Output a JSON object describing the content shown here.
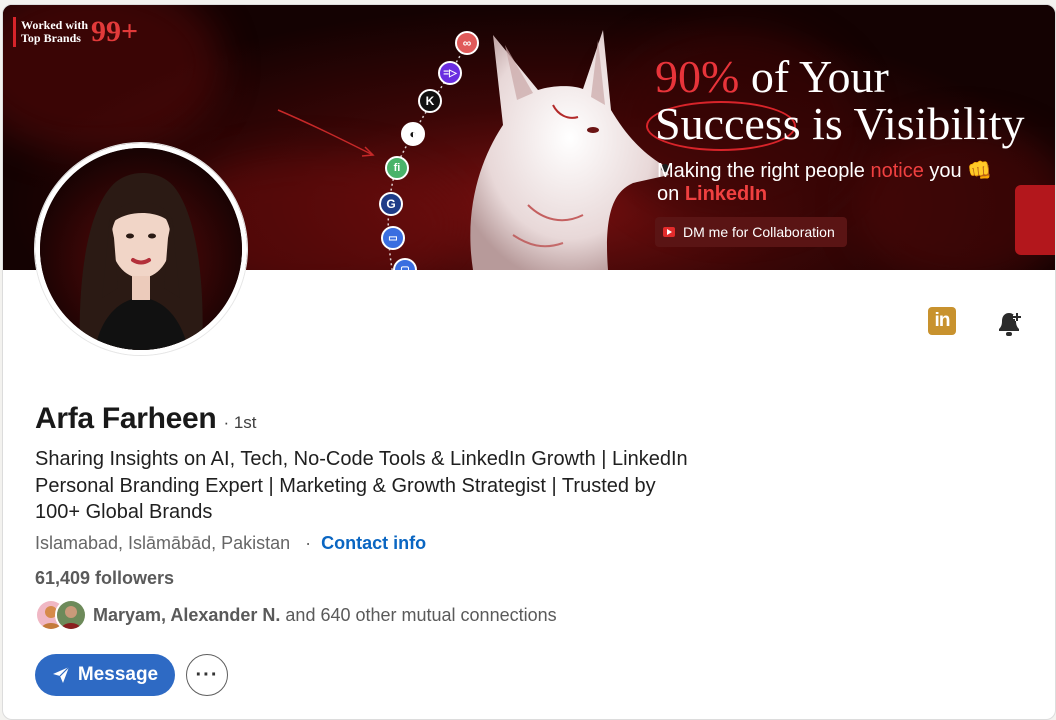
{
  "banner": {
    "badge_line1": "Worked with",
    "badge_line2": "Top Brands",
    "badge_count": "99+",
    "headline_pct": "90%",
    "headline_rest": " of Your",
    "headline_line2": "Success is Visibility",
    "sub_line1_pre": "Making the right people ",
    "sub_line1_red": "notice",
    "sub_line1_post": " you 👊",
    "sub_line2_pre": "on ",
    "sub_line2_red": "LinkedIn",
    "cta_label": "DM me for Collaboration",
    "chain_icons": [
      "link-brand-icon",
      "dial-brand-icon",
      "k-brand-icon",
      "ring-brand-icon",
      "leaf-brand-icon",
      "g-brand-icon",
      "window-brand-icon",
      "phone-brand-icon"
    ],
    "chain_letters": [
      "",
      "=▷",
      "K",
      "◐",
      "fi",
      "G",
      "▭",
      "▢"
    ],
    "colors": {
      "accent_red": "#e8343a",
      "dark_bg": "#140202"
    }
  },
  "profile": {
    "name": "Arfa Farheen",
    "degree": "· 1st",
    "headline": "Sharing Insights on AI, Tech, No-Code Tools & LinkedIn Growth | LinkedIn Personal Branding Expert | Marketing & Growth Strategist | Trusted by 100+ Global Brands",
    "location": "Islamabad, Islāmābād, Pakistan",
    "contact_sep": "·",
    "contact_label": "Contact info",
    "followers": "61,409 followers",
    "mutual_names": "Maryam, Alexander N.",
    "mutual_rest": " and 640 other mutual connections"
  },
  "actions": {
    "linkedin_badge": "in",
    "message_label": "Message",
    "more_label": "···"
  },
  "icons": {
    "linkedin": "linkedin-icon",
    "bell": "bell-plus-icon",
    "send": "paper-plane-icon",
    "more": "ellipsis-icon"
  },
  "colors": {
    "primary_blue": "#2e6ac4",
    "link_blue": "#0a66c2",
    "linkedin_gold": "#c8922e"
  }
}
